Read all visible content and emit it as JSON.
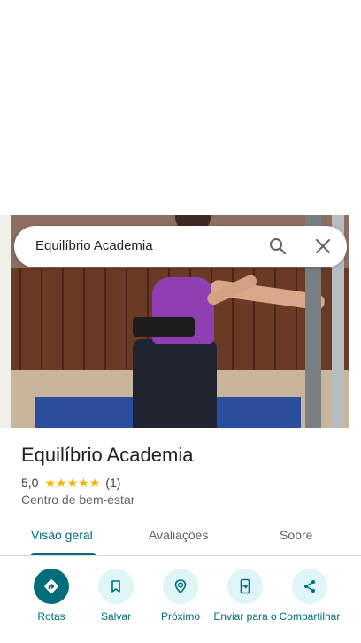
{
  "search": {
    "query": "Equilíbrio Academia",
    "search_icon": "search-icon",
    "close_icon": "close-icon"
  },
  "place": {
    "name": "Equilíbrio Academia",
    "rating": "5,0",
    "stars": 5,
    "review_count": "(1)",
    "category": "Centro de bem-estar"
  },
  "tabs": [
    {
      "label": "Visão geral",
      "active": true
    },
    {
      "label": "Avaliações",
      "active": false
    },
    {
      "label": "Sobre",
      "active": false
    }
  ],
  "actions": [
    {
      "label": "Rotas",
      "icon": "directions-icon"
    },
    {
      "label": "Salvar",
      "icon": "bookmark-icon"
    },
    {
      "label": "Próximo",
      "icon": "nearby-icon"
    },
    {
      "label": "Enviar para o",
      "icon": "send-to-phone-icon"
    },
    {
      "label": "Compartilhar",
      "icon": "share-icon"
    }
  ],
  "colors": {
    "accent": "#006d7a",
    "accent_light": "#dff5f7",
    "star": "#f6b400",
    "text": "#202124",
    "muted": "#5f6368"
  }
}
